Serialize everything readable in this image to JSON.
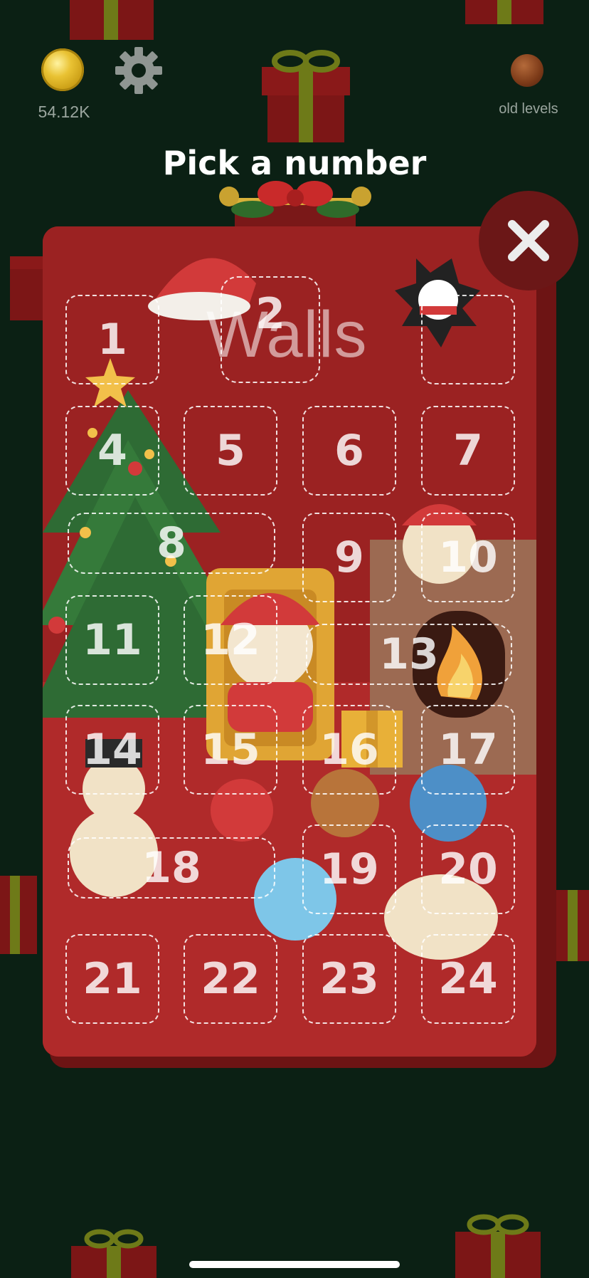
{
  "header": {
    "coin_count": "54.12K",
    "old_levels_label": "old levels",
    "icons": [
      "coin-icon",
      "gear-icon",
      "ball-icon"
    ]
  },
  "title": "Pick a number",
  "board": {
    "level_text": "Walls",
    "cells": [
      {
        "label": "1"
      },
      {
        "label": "2"
      },
      {
        "label": "4"
      },
      {
        "label": "5"
      },
      {
        "label": "6"
      },
      {
        "label": "7"
      },
      {
        "label": "8"
      },
      {
        "label": "9"
      },
      {
        "label": "10"
      },
      {
        "label": "11"
      },
      {
        "label": "12"
      },
      {
        "label": "13"
      },
      {
        "label": "14"
      },
      {
        "label": "15"
      },
      {
        "label": "16"
      },
      {
        "label": "17"
      },
      {
        "label": "18"
      },
      {
        "label": "19"
      },
      {
        "label": "20"
      },
      {
        "label": "21"
      },
      {
        "label": "22"
      },
      {
        "label": "23"
      },
      {
        "label": "24"
      }
    ],
    "close_icon": "close-icon",
    "colors": {
      "board": "#9b2222",
      "board_shadow": "#6d1414",
      "background": "#0b2014",
      "close_button": "#6b1717"
    }
  }
}
